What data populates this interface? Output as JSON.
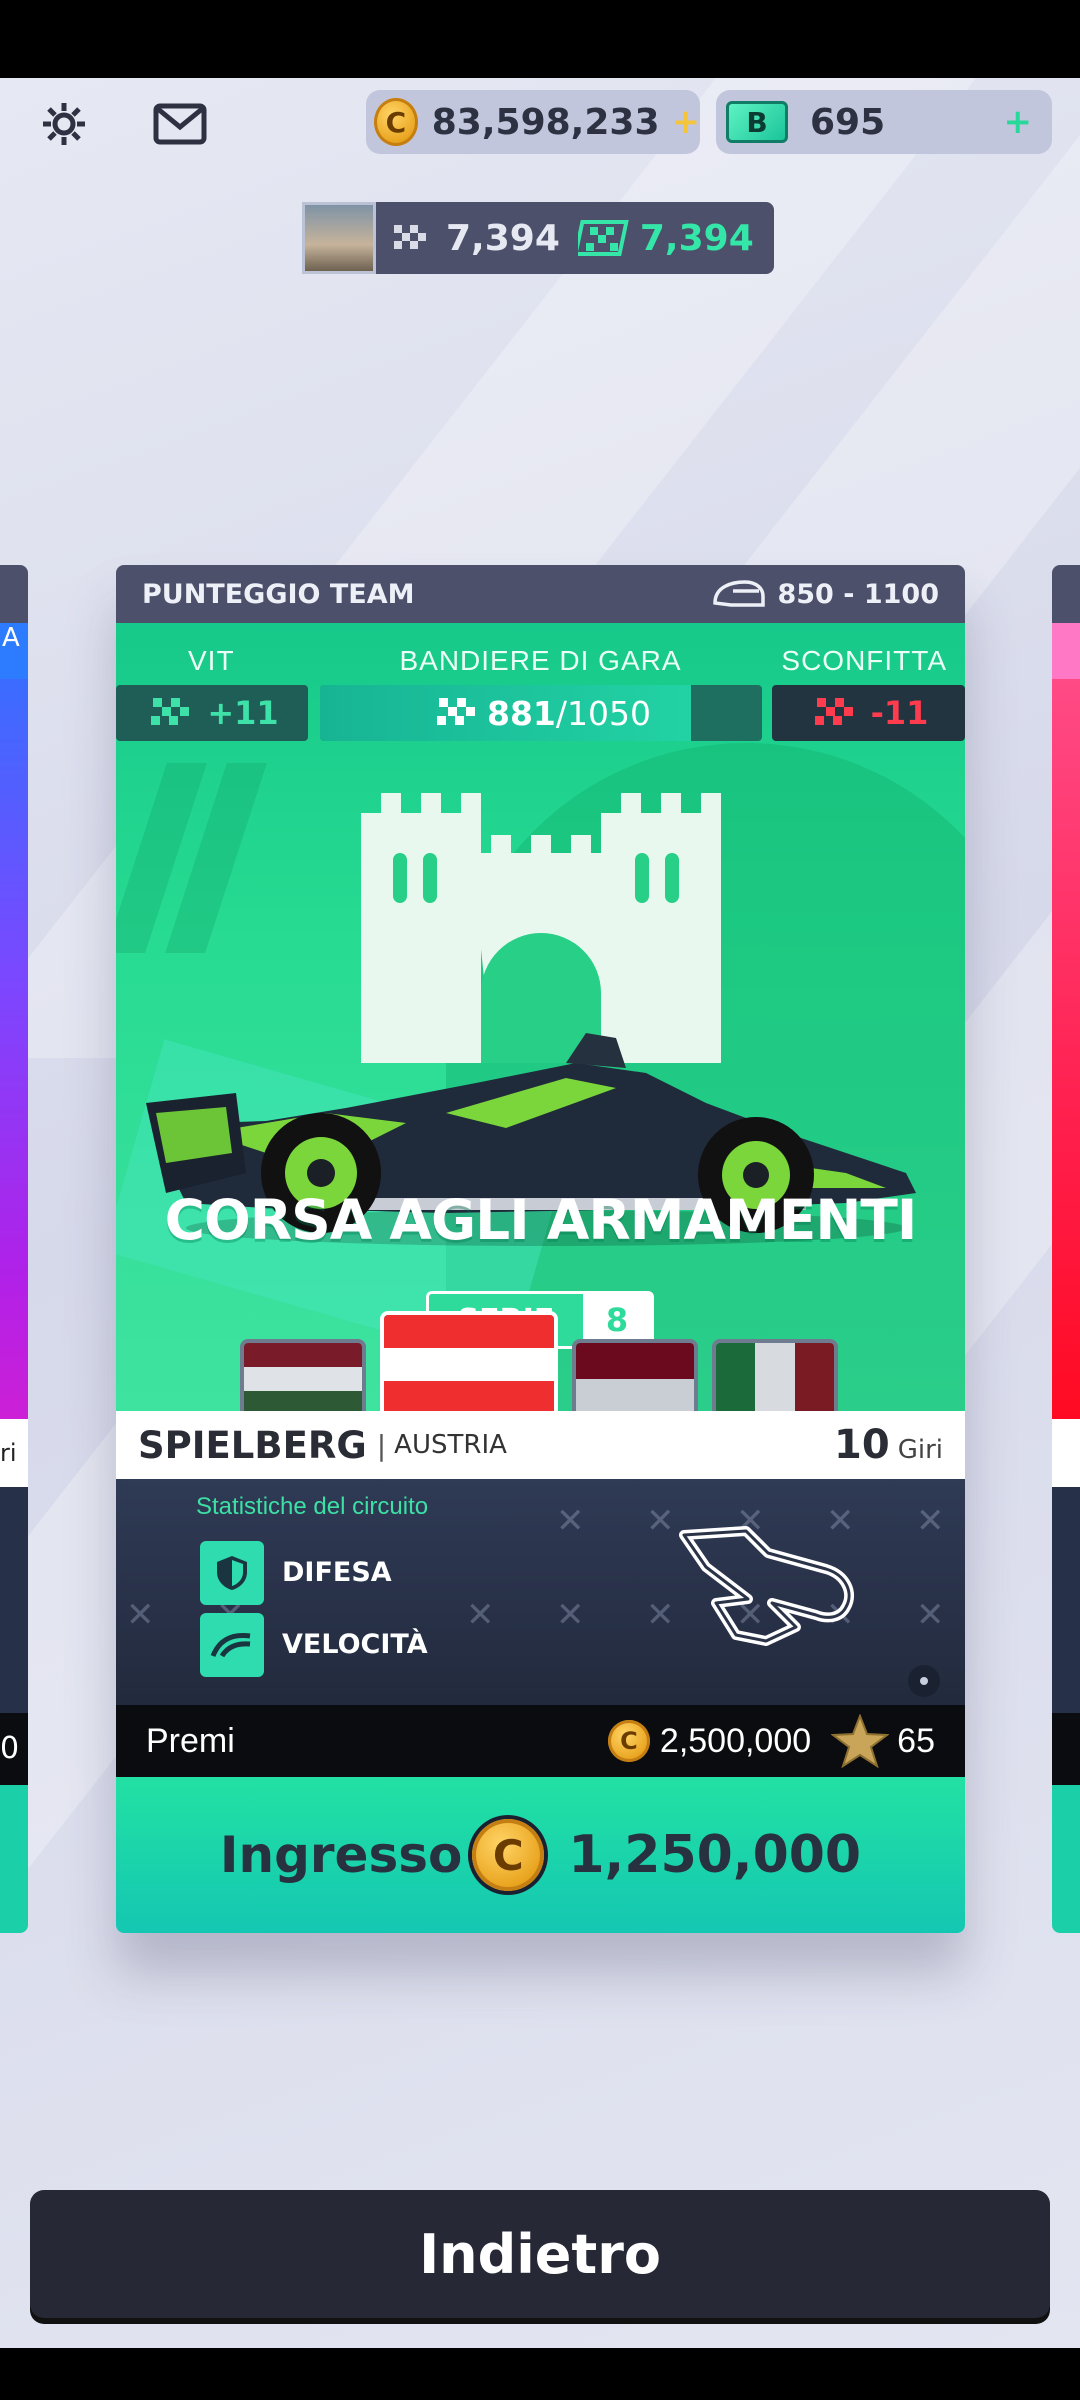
{
  "topbar": {
    "settings_icon": "gear-icon",
    "mail_icon": "envelope-icon",
    "coins": "83,598,233",
    "coin_symbol": "C",
    "bucks": "695",
    "bucks_symbol": "B"
  },
  "player": {
    "flags_before": "7,394",
    "flags_after": "7,394"
  },
  "card": {
    "team_score_label": "PUNTEGGIO TEAM",
    "team_score_range": "850 - 1100",
    "win_label": "VIT",
    "race_flags_label": "BANDIERE DI GARA",
    "loss_label": "SCONFITTA",
    "win_value": "+11",
    "race_flags_current": "881",
    "race_flags_total": "/1050",
    "race_flags_progress": 0.839,
    "loss_value": "-11",
    "event_title": "CORSA AGLI ARMAMENTI",
    "series_label": "SERIE",
    "series_number": "8",
    "track_name": "SPIELBERG",
    "track_country": "AUSTRIA",
    "laps_value": "10",
    "laps_label": "Giri",
    "circuit_stats_title": "Statistiche del circuito",
    "stat1": "DIFESA",
    "stat2": "VELOCITÀ",
    "prizes_label": "Premi",
    "prize_coins": "2,500,000",
    "prize_stars": "65",
    "entry_label": "Ingresso",
    "entry_cost": "1,250,000"
  },
  "left_card": {
    "label_a": "A",
    "label_giri": "ri",
    "label_num": "0"
  },
  "back_button": "Indietro",
  "colors": {
    "accent_green": "#22e1a3",
    "header_gray": "#4d506a",
    "win_green": "#2fd99a",
    "loss_red": "#ff3b4e",
    "dark_panel": "#262836"
  }
}
